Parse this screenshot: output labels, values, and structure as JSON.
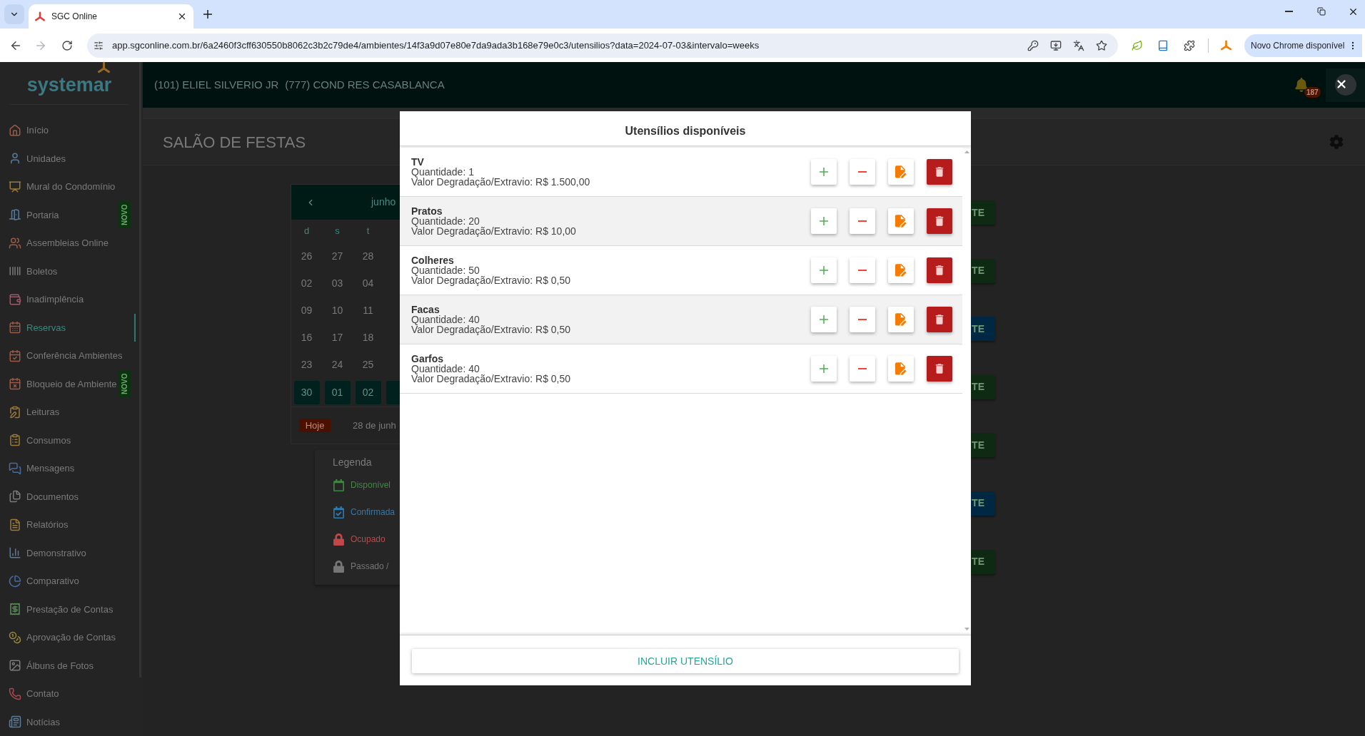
{
  "browser": {
    "tab": {
      "title": "SGC Online"
    },
    "back_disabled": false,
    "forward_disabled": true,
    "url": "app.sgconline.com.br/6a2460f3cff630550b8062c3b2c79de4/ambientes/14f3a9d07e80e7da9ada3b168e79e0c3/utensilios?data=2024-07-03&intervalo=weeks",
    "update_button": "Novo Chrome disponível"
  },
  "sidebar": {
    "logo": "systemar",
    "items": [
      {
        "label": "Início",
        "selected": false
      },
      {
        "label": "Unidades",
        "selected": false
      },
      {
        "label": "Mural do Condomínio",
        "selected": false
      },
      {
        "label": "Portaria",
        "selected": false,
        "badge": "NOVO"
      },
      {
        "label": "Assembleias Online",
        "selected": false
      },
      {
        "label": "Boletos",
        "selected": false
      },
      {
        "label": "Inadimplência",
        "selected": false
      },
      {
        "label": "Reservas",
        "selected": true
      },
      {
        "label": "Conferência Ambientes",
        "selected": false
      },
      {
        "label": "Bloqueio de Ambiente",
        "selected": false,
        "badge": "NOVO"
      },
      {
        "label": "Leituras",
        "selected": false
      },
      {
        "label": "Consumos",
        "selected": false
      },
      {
        "label": "Mensagens",
        "selected": false
      },
      {
        "label": "Documentos",
        "selected": false
      },
      {
        "label": "Relatórios",
        "selected": false
      },
      {
        "label": "Demonstrativo",
        "selected": false
      },
      {
        "label": "Comparativo",
        "selected": false
      },
      {
        "label": "Prestação de Contas",
        "selected": false
      },
      {
        "label": "Aprovação de Contas",
        "selected": false
      },
      {
        "label": "Álbuns de Fotos",
        "selected": false
      },
      {
        "label": "Contato",
        "selected": false
      },
      {
        "label": "Notícias",
        "selected": false
      }
    ]
  },
  "header": {
    "unit": "(101) ELIEL SILVERIO JR",
    "condominium": "(777) COND RES CASABLANCA",
    "notification_count": "187"
  },
  "page": {
    "title": "SALÃO DE FESTAS"
  },
  "calendar": {
    "month": "junho",
    "weekdays": [
      "d",
      "s",
      "t"
    ],
    "weeks": [
      {
        "days": [
          "26",
          "27",
          "28"
        ],
        "selected": false
      },
      {
        "days": [
          "02",
          "03",
          "04"
        ],
        "selected": false
      },
      {
        "days": [
          "09",
          "10",
          "11"
        ],
        "selected": false
      },
      {
        "days": [
          "16",
          "17",
          "18"
        ],
        "selected": false
      },
      {
        "days": [
          "23",
          "24",
          "25"
        ],
        "selected": false
      },
      {
        "days": [
          "30",
          "01",
          "02"
        ],
        "selected": true
      }
    ],
    "today_button": "Hoje",
    "date_label": "28 de junh"
  },
  "legend": {
    "title": "Legenda",
    "items": [
      {
        "label": "Disponível",
        "kind": "calendar",
        "color": "#3d8a40"
      },
      {
        "label": "Confirmada",
        "kind": "check",
        "color": "#2f7ab0"
      },
      {
        "label": "Ocupado",
        "kind": "lock",
        "color": "#c04848"
      },
      {
        "label": "Passado /",
        "kind": "lock",
        "color": "#767676"
      }
    ]
  },
  "slot_buttons": [
    {
      "label": "TE",
      "color": "#0f2a12"
    },
    {
      "label": "TE",
      "color": "#0f2a12"
    },
    {
      "label": "TE",
      "color": "#002843"
    },
    {
      "label": "TE",
      "color": "#0f2a12"
    },
    {
      "label": "TE",
      "color": "#0f2a12"
    },
    {
      "label": "TE",
      "color": "#002843"
    },
    {
      "label": "TE",
      "color": "#0f2a12"
    }
  ],
  "modal": {
    "title": "Utensílios disponíveis",
    "items": [
      {
        "name": "TV",
        "quantity": "Quantidade: 1",
        "value": "Valor Degradação/Extravio: R$ 1.500,00"
      },
      {
        "name": "Pratos",
        "quantity": "Quantidade: 20",
        "value": "Valor Degradação/Extravio: R$ 10,00"
      },
      {
        "name": "Colheres",
        "quantity": "Quantidade: 50",
        "value": "Valor Degradação/Extravio: R$ 0,50"
      },
      {
        "name": "Facas",
        "quantity": "Quantidade: 40",
        "value": "Valor Degradação/Extravio: R$ 0,50"
      },
      {
        "name": "Garfos",
        "quantity": "Quantidade: 40",
        "value": "Valor Degradação/Extravio: R$ 0,50"
      }
    ],
    "add_button": "INCLUIR UTENSÍLIO"
  }
}
